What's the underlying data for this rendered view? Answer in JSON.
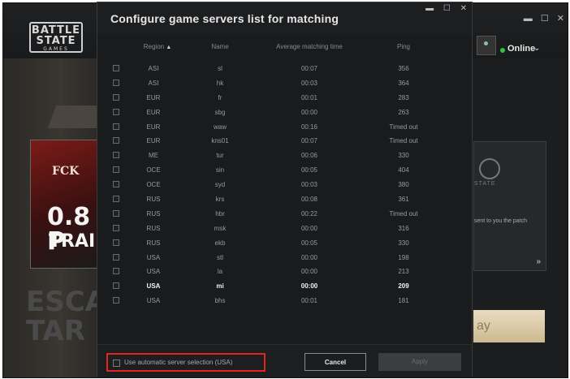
{
  "background": {
    "logo": {
      "line1": "BATTLE",
      "line2": "STATE",
      "line3": "GAMES"
    },
    "window_controls": [
      "▬",
      "☐",
      "✕"
    ],
    "status": {
      "label": "Online",
      "color": "#2fc24a"
    },
    "trailer": {
      "badge": "FCK",
      "title": "0.8 P",
      "subtitle": "TRAILE"
    },
    "game_logo": "ESCA\nTAR",
    "news": {
      "brand": "STATE",
      "snippet": "sent to you the patch",
      "more": "»"
    },
    "play_button": "ay"
  },
  "dialog": {
    "title": "Configure game servers list for matching",
    "window_controls": [
      "▬",
      "☐",
      "✕"
    ],
    "columns": {
      "region": "Region",
      "sort_icon": "▲",
      "name": "Name",
      "time": "Average matching time",
      "ping": "Ping"
    },
    "rows": [
      {
        "region": "ASI",
        "name": "sl",
        "time": "00:07",
        "ping": "356"
      },
      {
        "region": "ASI",
        "name": "hk",
        "time": "00:03",
        "ping": "364"
      },
      {
        "region": "EUR",
        "name": "fr",
        "time": "00:01",
        "ping": "283"
      },
      {
        "region": "EUR",
        "name": "sbg",
        "time": "00:00",
        "ping": "263"
      },
      {
        "region": "EUR",
        "name": "waw",
        "time": "00:16",
        "ping": "Timed out"
      },
      {
        "region": "EUR",
        "name": "kns01",
        "time": "00:07",
        "ping": "Timed out"
      },
      {
        "region": "ME",
        "name": "tur",
        "time": "00:06",
        "ping": "330"
      },
      {
        "region": "OCE",
        "name": "sin",
        "time": "00:05",
        "ping": "404"
      },
      {
        "region": "OCE",
        "name": "syd",
        "time": "00:03",
        "ping": "380"
      },
      {
        "region": "RUS",
        "name": "krs",
        "time": "00:08",
        "ping": "361"
      },
      {
        "region": "RUS",
        "name": "hbr",
        "time": "00:22",
        "ping": "Timed out"
      },
      {
        "region": "RUS",
        "name": "msk",
        "time": "00:00",
        "ping": "316"
      },
      {
        "region": "RUS",
        "name": "ekb",
        "time": "00:05",
        "ping": "330"
      },
      {
        "region": "USA",
        "name": "stl",
        "time": "00:00",
        "ping": "198"
      },
      {
        "region": "USA",
        "name": "la",
        "time": "00:00",
        "ping": "213"
      },
      {
        "region": "USA",
        "name": "mi",
        "time": "00:00",
        "ping": "209",
        "selected": true
      },
      {
        "region": "USA",
        "name": "bhs",
        "time": "00:01",
        "ping": "181"
      }
    ],
    "auto_select_label": "Use automatic server selection (USA)",
    "cancel_label": "Cancel",
    "apply_label": "Apply",
    "highlight_color": "#e0261f"
  }
}
